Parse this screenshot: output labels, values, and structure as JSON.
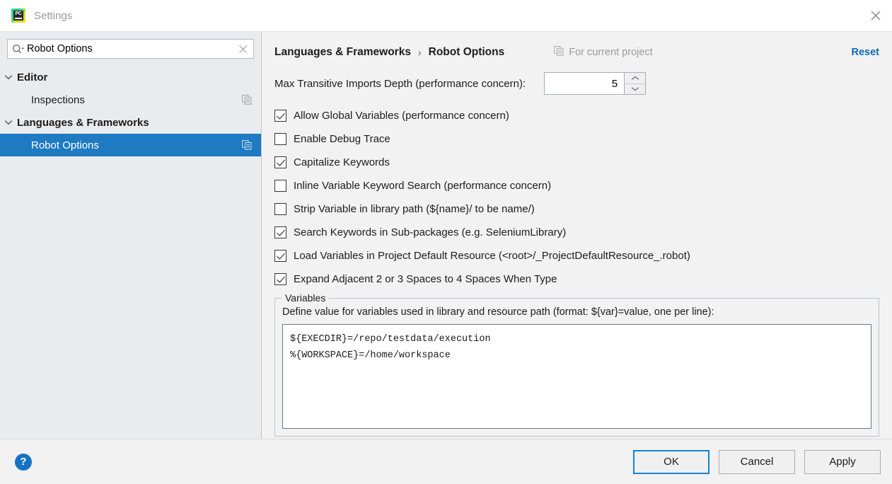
{
  "window": {
    "title": "Settings",
    "app_icon": "pycharm-icon",
    "close_icon": "close-icon"
  },
  "sidebar": {
    "search": {
      "value": "Robot Options",
      "placeholder": "",
      "search_icon": "search-icon",
      "clear_icon": "clear-icon"
    },
    "items": [
      {
        "label": "Editor",
        "type": "group",
        "expanded": true,
        "selected": false,
        "copy_icon": false
      },
      {
        "label": "Inspections",
        "type": "child",
        "expanded": false,
        "selected": false,
        "copy_icon": true
      },
      {
        "label": "Languages & Frameworks",
        "type": "group",
        "expanded": true,
        "selected": false,
        "copy_icon": false
      },
      {
        "label": "Robot Options",
        "type": "child",
        "expanded": false,
        "selected": true,
        "copy_icon": true
      }
    ]
  },
  "main": {
    "breadcrumb": {
      "parent": "Languages & Frameworks",
      "separator": "›",
      "current": "Robot Options"
    },
    "for_current_project": {
      "label": "For current project",
      "icon": "copy-project-icon"
    },
    "reset_label": "Reset",
    "depth_setting": {
      "label": "Max Transitive Imports Depth (performance concern):",
      "value": "5",
      "up_icon": "chevron-up-icon",
      "down_icon": "chevron-down-icon"
    },
    "checkboxes": [
      {
        "label": "Allow Global Variables (performance concern)",
        "checked": true
      },
      {
        "label": "Enable Debug Trace",
        "checked": false
      },
      {
        "label": "Capitalize Keywords",
        "checked": true
      },
      {
        "label": "Inline Variable Keyword Search (performance concern)",
        "checked": false
      },
      {
        "label": "Strip Variable in library path (${name}/ to be name/)",
        "checked": false
      },
      {
        "label": "Search Keywords in Sub-packages (e.g. SeleniumLibrary)",
        "checked": true
      },
      {
        "label": "Load Variables in Project Default Resource (<root>/_ProjectDefaultResource_.robot)",
        "checked": true
      },
      {
        "label": "Expand Adjacent 2 or 3 Spaces to 4 Spaces When Type",
        "checked": true
      }
    ],
    "variables_group": {
      "title": "Variables",
      "description": "Define value for variables used in library and resource path (format: ${var}=value, one per line):",
      "value": "${EXECDIR}=/repo/testdata/execution\n%{WORKSPACE}=/home/workspace"
    }
  },
  "footer": {
    "help_label": "?",
    "help_icon": "help-icon",
    "buttons": [
      {
        "label": "OK",
        "default": true
      },
      {
        "label": "Cancel",
        "default": false
      },
      {
        "label": "Apply",
        "default": false
      }
    ]
  },
  "colors": {
    "selection_blue": "#1e7ac1",
    "link_blue": "#0d6cb3",
    "focus_blue": "#1583d6",
    "sidebar_bg": "#e8ecef",
    "panel_bg": "#f2f2f2"
  }
}
